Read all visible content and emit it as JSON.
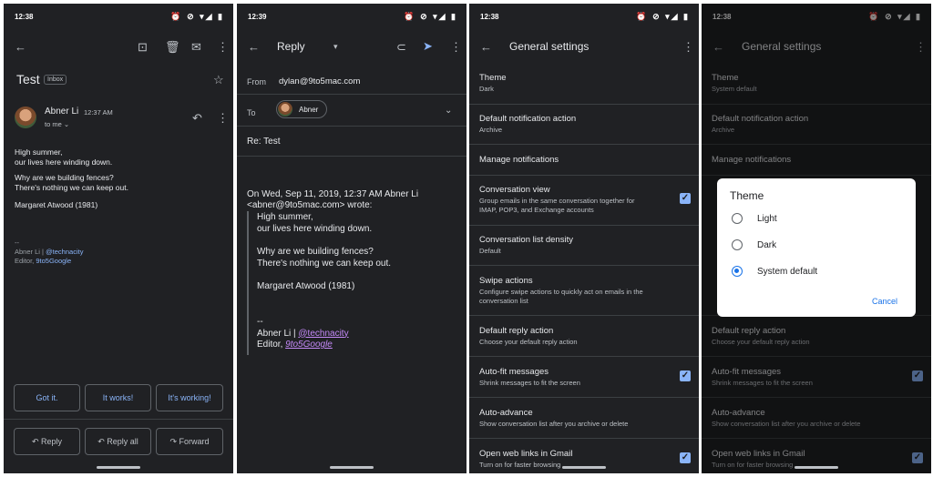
{
  "panel1": {
    "status_time": "12:38",
    "subject": "Test",
    "badge": "Inbox",
    "sender": "Abner Li",
    "time": "12:37 AM",
    "to": "to me",
    "body": [
      "High summer,",
      "our lives here winding down.",
      "",
      "Why are we building fences?",
      "There's nothing we can keep out.",
      "",
      "Margaret Atwood (1981)"
    ],
    "sig_dash": "--",
    "sig_name": "Abner Li | ",
    "sig_handle": "@technacity",
    "sig_role": "Editor, ",
    "sig_site": "9to5Google",
    "smart_replies": [
      "Got it.",
      "It works!",
      "It's working!"
    ],
    "actions": [
      "Reply",
      "Reply all",
      "Forward"
    ]
  },
  "panel2": {
    "status_time": "12:39",
    "title": "Reply",
    "from_label": "From",
    "from_value": "dylan@9to5mac.com",
    "to_label": "To",
    "to_chip": "Abner",
    "subject": "Re: Test",
    "quote_header_1": "On Wed, Sep 11, 2019, 12:37 AM Abner Li",
    "quote_header_2": "<abner@9to5mac.com> wrote:",
    "quote": [
      "High summer,",
      "our lives here winding down.",
      "",
      "Why are we building fences?",
      "There's nothing we can keep out.",
      "",
      "Margaret Atwood (1981)"
    ],
    "sig_dash": "--",
    "sig_name": "Abner Li | ",
    "sig_handle": "@technacity",
    "sig_role": "Editor, ",
    "sig_site": "9to5Google"
  },
  "panel3": {
    "status_time": "12:38",
    "title": "General settings",
    "items": [
      {
        "title": "Theme",
        "sub": "Dark"
      },
      {
        "title": "Default notification action",
        "sub": "Archive"
      },
      {
        "title": "Manage notifications",
        "sub": ""
      },
      {
        "title": "Conversation view",
        "sub": "Group emails in the same conversation together for",
        "sub2": "IMAP, POP3, and Exchange accounts",
        "checked": true
      },
      {
        "title": "Conversation list density",
        "sub": "Default"
      },
      {
        "title": "Swipe actions",
        "sub": "Configure swipe actions to quickly act on emails in the",
        "sub2": "conversation list"
      },
      {
        "title": "Default reply action",
        "sub": "Choose your default reply action"
      },
      {
        "title": "Auto-fit messages",
        "sub": "Shrink messages to fit the screen",
        "checked": true
      },
      {
        "title": "Auto-advance",
        "sub": "Show conversation list after you archive or delete"
      },
      {
        "title": "Open web links in Gmail",
        "sub": "Turn on for faster browsing",
        "checked": true
      }
    ]
  },
  "panel4": {
    "status_time": "12:38",
    "title": "General settings",
    "items": [
      {
        "title": "Theme",
        "sub": "System default"
      },
      {
        "title": "Default notification action",
        "sub": "Archive"
      },
      {
        "title": "Manage notifications",
        "sub": ""
      },
      {
        "title": "Default reply action",
        "sub": "Choose your default reply action"
      },
      {
        "title": "Auto-fit messages",
        "sub": "Shrink messages to fit the screen",
        "checked": true
      },
      {
        "title": "Auto-advance",
        "sub": "Show conversation list after you archive or delete"
      },
      {
        "title": "Open web links in Gmail",
        "sub": "Turn on for faster browsing",
        "checked": true
      }
    ],
    "dialog": {
      "title": "Theme",
      "options": [
        "Light",
        "Dark",
        "System default"
      ],
      "selected": "System default",
      "cancel": "Cancel"
    }
  }
}
